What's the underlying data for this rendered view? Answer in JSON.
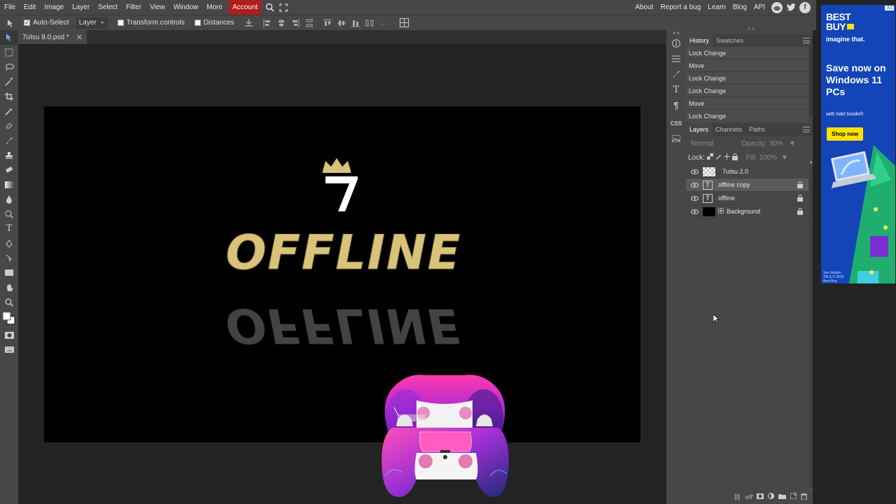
{
  "menubar": {
    "items": [
      "File",
      "Edit",
      "Image",
      "Layer",
      "Select",
      "Filter",
      "View",
      "Window",
      "More"
    ],
    "account_label": "Account",
    "right_links": [
      "About",
      "Report a bug",
      "Learn",
      "Blog",
      "API"
    ],
    "social_icons": [
      "reddit-icon",
      "twitter-icon",
      "facebook-icon"
    ]
  },
  "optbar": {
    "auto_select_label": "Auto-Select",
    "auto_select_checked": true,
    "target_value": "Layer",
    "transform_label": "Transform controls",
    "distances_label": "Distances"
  },
  "document": {
    "tab_title": "7utsu 8.0.psd *",
    "canvas_text": "OFFLINE",
    "accent_color": "#d9c27a"
  },
  "history": {
    "tabs": [
      "History",
      "Swatches"
    ],
    "items": [
      "Lock Change",
      "Move",
      "Lock Change",
      "Lock Change",
      "Move",
      "Lock Change"
    ]
  },
  "layers": {
    "tabs": [
      "Layers",
      "Channels",
      "Paths"
    ],
    "blend_mode": "Normal",
    "opacity_label": "Opacity:",
    "opacity_value": "30%",
    "lock_label": "Lock:",
    "fill_label": "Fill:",
    "fill_value": "100%",
    "items": [
      {
        "name": "7utsu 2.0",
        "type": "image",
        "locked": false
      },
      {
        "name": "offline copy",
        "type": "text",
        "locked": true
      },
      {
        "name": "offline",
        "type": "text",
        "locked": true
      },
      {
        "name": "Background",
        "type": "fill",
        "locked": true
      }
    ]
  },
  "ad": {
    "brand_line1": "BEST",
    "brand_line2": "BUY",
    "tagline": "imagine that.",
    "headline": "Save now on Windows 11 PCs",
    "sub": "with Intel Inside®.",
    "cta": "Shop now",
    "fine_print_1": "See details.",
    "fine_print_2": "TM & © 2025",
    "fine_print_3": "Best Buy",
    "ad_badge": "Ad"
  }
}
